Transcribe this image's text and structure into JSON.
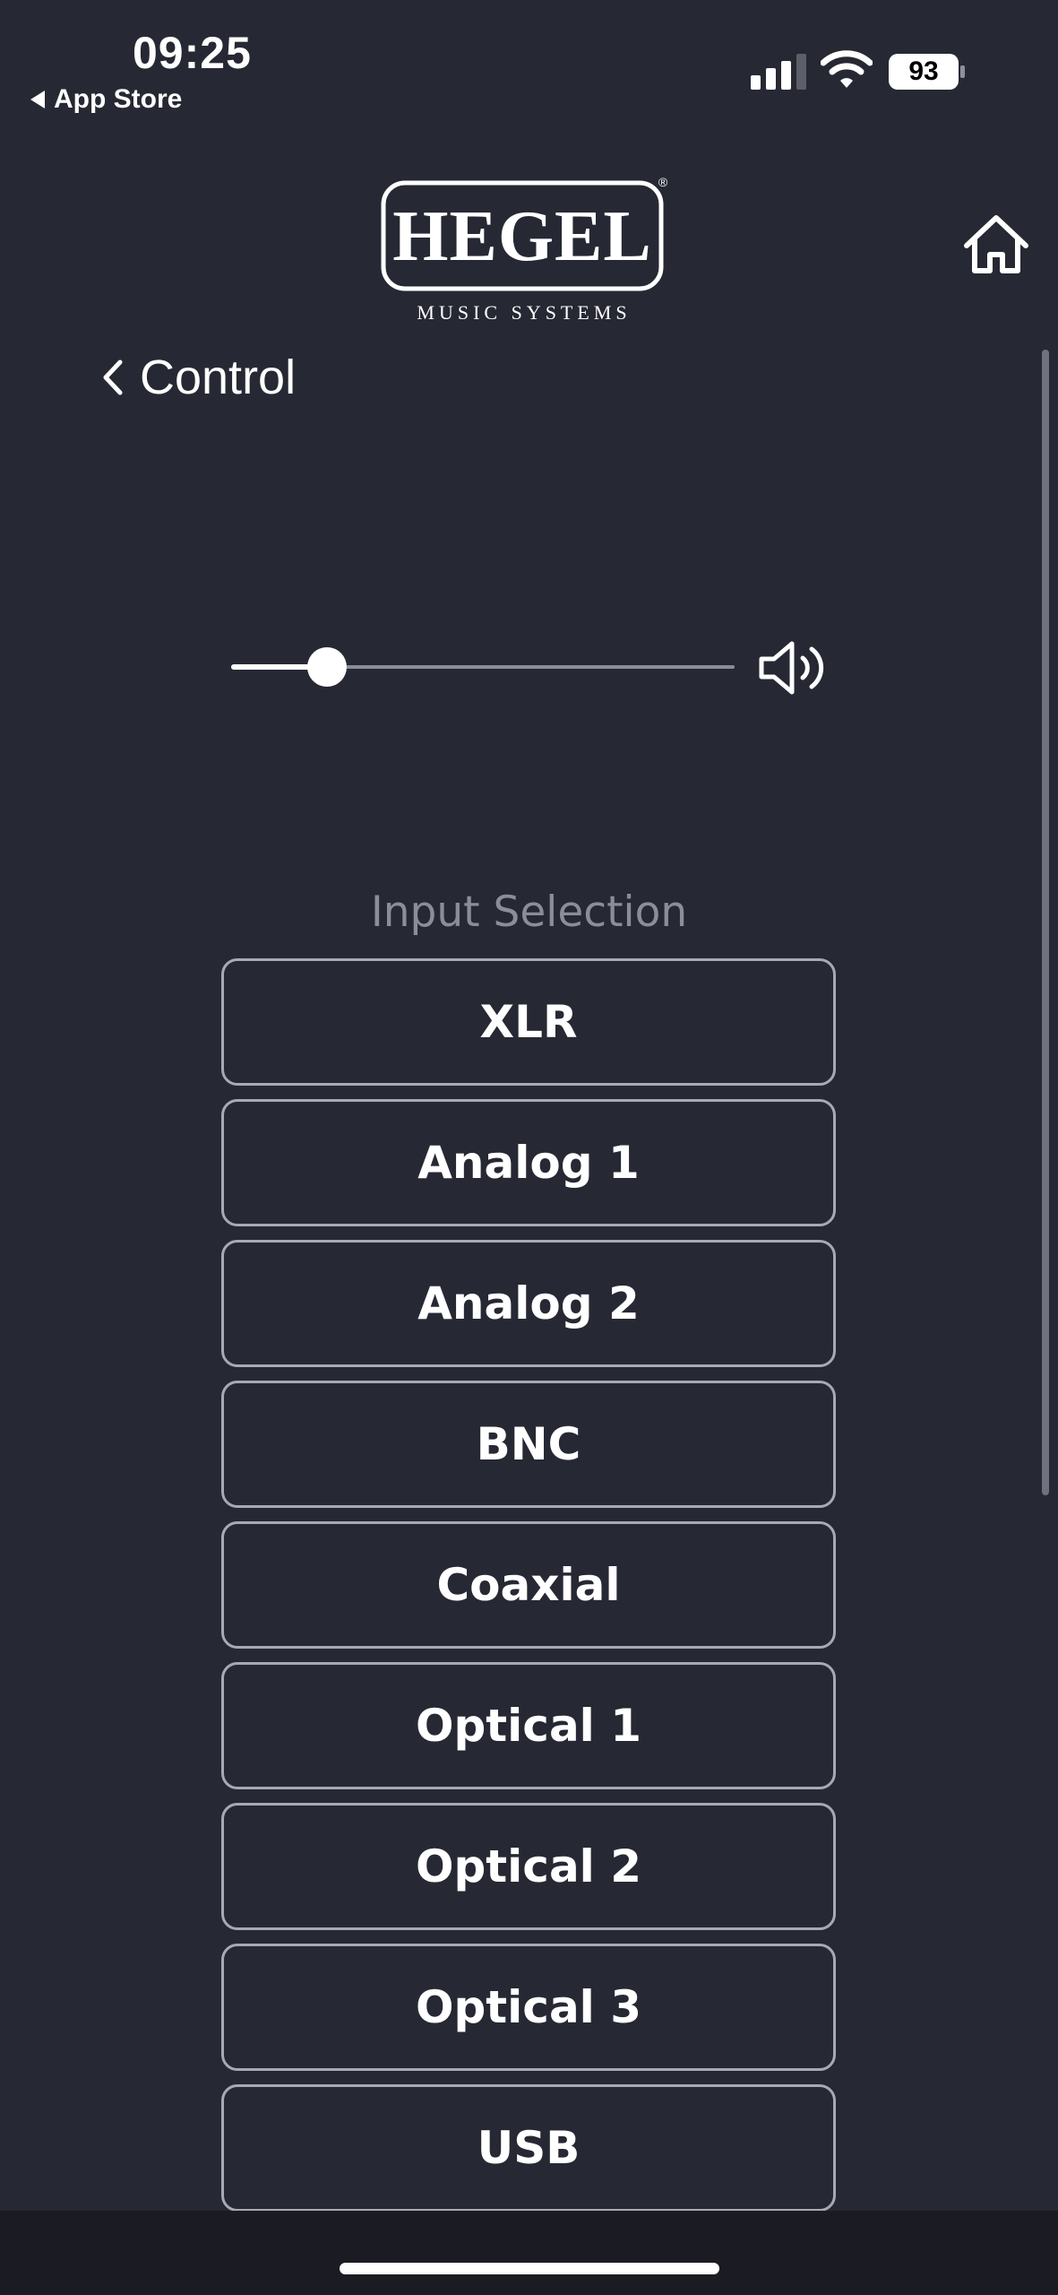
{
  "status_bar": {
    "time": "09:25",
    "back_app_label": "App Store",
    "battery_level": "93",
    "signal_bars_active": 3,
    "signal_bars_total": 4
  },
  "header": {
    "logo_wordmark": "HEGEL",
    "logo_tagline": "MUSIC SYSTEMS",
    "logo_registered": "®",
    "home_icon": "home-icon",
    "back_label": "Control",
    "back_icon": "chevron-left-icon"
  },
  "volume": {
    "level": 0.19,
    "icon": "speaker-volume-icon"
  },
  "input_selection": {
    "title": "Input Selection",
    "options": [
      {
        "label": "XLR"
      },
      {
        "label": "Analog 1"
      },
      {
        "label": "Analog 2"
      },
      {
        "label": "BNC"
      },
      {
        "label": "Coaxial"
      },
      {
        "label": "Optical 1"
      },
      {
        "label": "Optical 2"
      },
      {
        "label": "Optical 3"
      },
      {
        "label": "USB"
      }
    ]
  },
  "colors": {
    "background": "#262833",
    "button_border": "#a8aab3",
    "section_title": "#8b8d9a",
    "bottom_bar": "#1b1c23"
  }
}
